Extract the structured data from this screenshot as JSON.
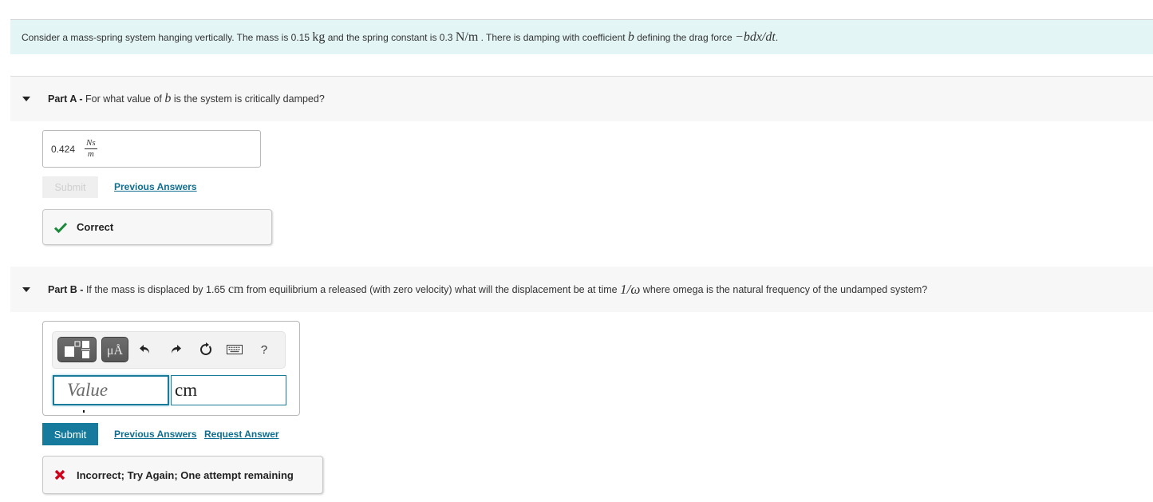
{
  "intro": {
    "segments": [
      {
        "text": "Consider a mass-spring system hanging vertically. The mass is 0.15 ",
        "style": "text"
      },
      {
        "text": "kg",
        "style": "mr"
      },
      {
        "text": " and the spring constant is 0.3 ",
        "style": "text"
      },
      {
        "text": "N/m",
        "style": "mr"
      },
      {
        "text": " . There is damping with coefficient ",
        "style": "text"
      },
      {
        "text": "b",
        "style": "mi"
      },
      {
        "text": " defining the drag force ",
        "style": "text"
      },
      {
        "text": "−bdx/dt",
        "style": "mi"
      },
      {
        "text": ".",
        "style": "text"
      }
    ]
  },
  "part_a": {
    "label": "Part A - ",
    "question_pre": "For what value of ",
    "question_var": "b",
    "question_post": " is the system is critically damped?",
    "answer_value": "0.424",
    "answer_unit_num": "Ns",
    "answer_unit_den": "m",
    "submit_label": "Submit",
    "previous_answers_label": "Previous Answers",
    "feedback_text": "Correct",
    "feedback_color": "#1a8a3a"
  },
  "part_b": {
    "label": "Part B - ",
    "question_pre": "If the mass is displaced by 1.65 ",
    "question_unit": "cm",
    "question_mid": " from equilibrium a released (with zero velocity) what will the displacement be at time ",
    "question_expr": "1/ω",
    "question_post": " where omega is the natural frequency of the undamped system?",
    "toolbar": {
      "templates_icon": "templates-icon",
      "units_label": "μÅ",
      "undo_icon": "undo-icon",
      "redo_icon": "redo-icon",
      "reset_icon": "reset-icon",
      "keyboard_icon": "keyboard-icon",
      "help_label": "?"
    },
    "value_placeholder": "Value",
    "value": "",
    "unit_value": "cm",
    "submit_label": "Submit",
    "previous_answers_label": "Previous Answers",
    "request_answer_label": "Request Answer",
    "feedback_text": "Incorrect; Try Again; One attempt remaining",
    "feedback_color": "#d0021b"
  },
  "colors": {
    "intro_bg": "#e4f5f5",
    "part_header_bg": "#f7f7f7",
    "accent": "#157a9c",
    "link": "#0f6e8f"
  }
}
